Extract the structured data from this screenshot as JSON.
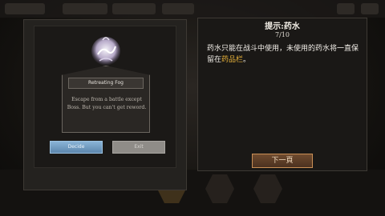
{
  "event_card": {
    "title": "Retreating Fog",
    "description": "Escape from a battle except Boss. But you can't get reword.",
    "confirm_label": "Decide",
    "other_label": "Exit"
  },
  "tip": {
    "title": "提示:药水",
    "page": "7/10",
    "body_before": "药水只能在战斗中使用，未使用的药水将一直保留在",
    "body_highlight": "药品栏",
    "body_after": "。",
    "next_label": "下一頁"
  },
  "colors": {
    "highlight": "#e8b23a",
    "confirm_button": "#7aa6cc",
    "next_button_border": "#c88e55"
  }
}
